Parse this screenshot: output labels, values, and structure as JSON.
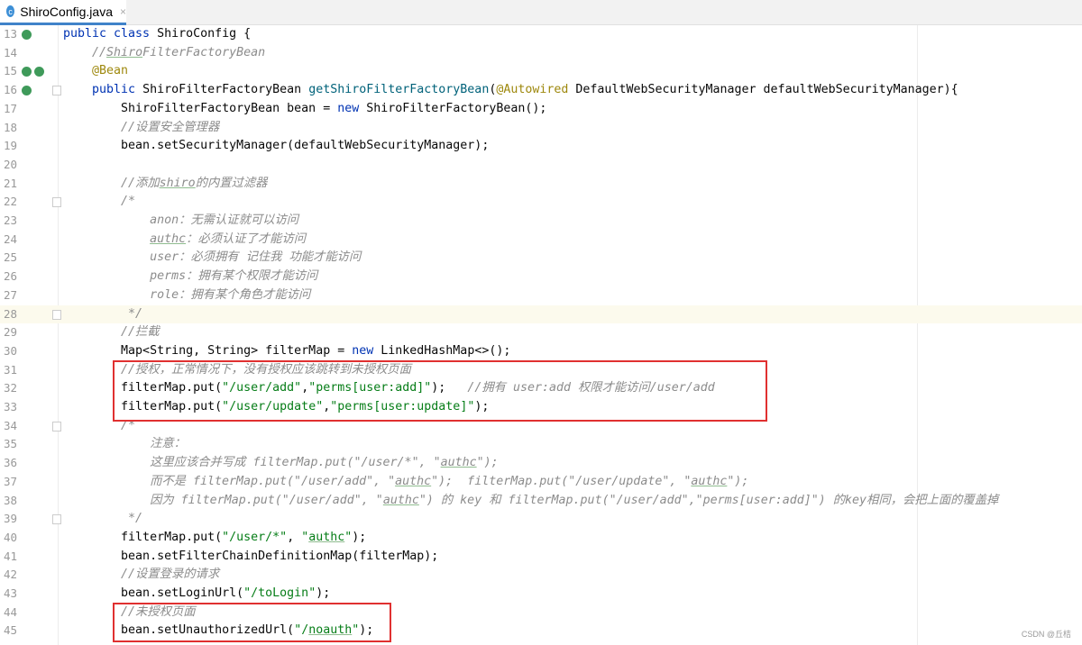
{
  "tab": {
    "icon": "c",
    "title": "ShiroConfig.java",
    "close": "×"
  },
  "watermark": "CSDN @丘桔",
  "lines": [
    {
      "n": "13",
      "t": [
        [
          "public class ",
          "kw"
        ],
        [
          "ShiroConfig {",
          ""
        ]
      ]
    },
    {
      "n": "14",
      "t": [
        [
          "    //",
          "cm"
        ],
        [
          "Shiro",
          "cm ul"
        ],
        [
          "FilterFactoryBean",
          "cm"
        ]
      ]
    },
    {
      "n": "15",
      "t": [
        [
          "    @Bean",
          "an"
        ]
      ]
    },
    {
      "n": "16",
      "t": [
        [
          "    public ",
          "kw"
        ],
        [
          "ShiroFilterFactoryBean ",
          ""
        ],
        [
          "getShiroFilterFactoryBean",
          "me"
        ],
        [
          "(",
          ""
        ],
        [
          "@Autowired ",
          "an"
        ],
        [
          "DefaultWebSecurityManager defaultWebSecurityManager){",
          ""
        ]
      ]
    },
    {
      "n": "17",
      "t": [
        [
          "        ShiroFilterFactoryBean bean = ",
          ""
        ],
        [
          "new ",
          "kw"
        ],
        [
          "ShiroFilterFactoryBean();",
          ""
        ]
      ]
    },
    {
      "n": "18",
      "t": [
        [
          "        //设置安全管理器",
          "cm"
        ]
      ]
    },
    {
      "n": "19",
      "t": [
        [
          "        bean.setSecurityManager(defaultWebSecurityManager);",
          ""
        ]
      ]
    },
    {
      "n": "20",
      "t": []
    },
    {
      "n": "21",
      "t": [
        [
          "        //添加",
          "cm"
        ],
        [
          "shiro",
          "cm ul"
        ],
        [
          "的内置过滤器",
          "cm"
        ]
      ]
    },
    {
      "n": "22",
      "t": [
        [
          "        /*",
          "cm"
        ]
      ]
    },
    {
      "n": "23",
      "t": [
        [
          "            anon：无需认证就可以访问",
          "cm"
        ]
      ]
    },
    {
      "n": "24",
      "t": [
        [
          "            ",
          "cm"
        ],
        [
          "authc",
          "cm ul"
        ],
        [
          "：必须认证了才能访问",
          "cm"
        ]
      ]
    },
    {
      "n": "25",
      "t": [
        [
          "            user：必须拥有 记住我 功能才能访问",
          "cm"
        ]
      ]
    },
    {
      "n": "26",
      "t": [
        [
          "            perms：拥有某个权限才能访问",
          "cm"
        ]
      ]
    },
    {
      "n": "27",
      "t": [
        [
          "            role：拥有某个角色才能访问",
          "cm"
        ]
      ]
    },
    {
      "n": "28",
      "t": [
        [
          "         */",
          "cm"
        ]
      ]
    },
    {
      "n": "29",
      "t": [
        [
          "        //拦截",
          "cm"
        ]
      ]
    },
    {
      "n": "30",
      "t": [
        [
          "        Map<String, String> filterMap = ",
          ""
        ],
        [
          "new ",
          "kw"
        ],
        [
          "LinkedHashMap<>();",
          ""
        ]
      ]
    },
    {
      "n": "31",
      "t": [
        [
          "        //授权，正常情况下，没有授权应该跳转到未授权页面",
          "cm"
        ]
      ]
    },
    {
      "n": "32",
      "t": [
        [
          "        filterMap.put(",
          ""
        ],
        [
          "\"/user/add\"",
          "str"
        ],
        [
          ",",
          ""
        ],
        [
          "\"perms[user:add]\"",
          "str"
        ],
        [
          ");   ",
          ""
        ],
        [
          "//拥有 user:add 权限才能访问/user/add",
          "cm"
        ]
      ]
    },
    {
      "n": "33",
      "t": [
        [
          "        filterMap.put(",
          ""
        ],
        [
          "\"/user/update\"",
          "str"
        ],
        [
          ",",
          ""
        ],
        [
          "\"perms[user:update]\"",
          "str"
        ],
        [
          ");",
          ""
        ]
      ]
    },
    {
      "n": "34",
      "t": [
        [
          "        /*",
          "cm"
        ]
      ]
    },
    {
      "n": "35",
      "t": [
        [
          "            注意：",
          "cm"
        ]
      ]
    },
    {
      "n": "36",
      "t": [
        [
          "            这里应该合并写成 filterMap.put(\"/user/*\", \"",
          "cm"
        ],
        [
          "authc",
          "cm ul"
        ],
        [
          "\");",
          "cm"
        ]
      ]
    },
    {
      "n": "37",
      "t": [
        [
          "            而不是 filterMap.put(\"/user/add\", \"",
          "cm"
        ],
        [
          "authc",
          "cm ul"
        ],
        [
          "\");  filterMap.put(\"/user/update\", \"",
          "cm"
        ],
        [
          "authc",
          "cm ul"
        ],
        [
          "\");",
          "cm"
        ]
      ]
    },
    {
      "n": "38",
      "t": [
        [
          "            因为 filterMap.put(\"/user/add\", \"",
          "cm"
        ],
        [
          "authc",
          "cm ul"
        ],
        [
          "\") 的 key 和 filterMap.put(\"/user/add\",\"perms[user:add]\") 的key相同，会把上面的覆盖掉",
          "cm"
        ]
      ]
    },
    {
      "n": "39",
      "t": [
        [
          "         */",
          "cm"
        ]
      ]
    },
    {
      "n": "40",
      "t": [
        [
          "        filterMap.put(",
          ""
        ],
        [
          "\"/user/*\"",
          "str"
        ],
        [
          ", ",
          ""
        ],
        [
          "\"",
          "str"
        ],
        [
          "authc",
          "str ul"
        ],
        [
          "\"",
          "str"
        ],
        [
          ");",
          ""
        ]
      ]
    },
    {
      "n": "41",
      "t": [
        [
          "        bean.setFilterChainDefinitionMap(filterMap);",
          ""
        ]
      ]
    },
    {
      "n": "42",
      "t": [
        [
          "        //设置登录的请求",
          "cm"
        ]
      ]
    },
    {
      "n": "43",
      "t": [
        [
          "        bean.setLoginUrl(",
          ""
        ],
        [
          "\"/toLogin\"",
          "str"
        ],
        [
          ");",
          ""
        ]
      ]
    },
    {
      "n": "44",
      "t": [
        [
          "        //未授权页面",
          "cm"
        ]
      ]
    },
    {
      "n": "45",
      "t": [
        [
          "        bean.setUnauthorizedUrl(",
          ""
        ],
        [
          "\"/",
          "str"
        ],
        [
          "noauth",
          "str ul"
        ],
        [
          "\"",
          "str"
        ],
        [
          ");",
          ""
        ]
      ]
    }
  ]
}
